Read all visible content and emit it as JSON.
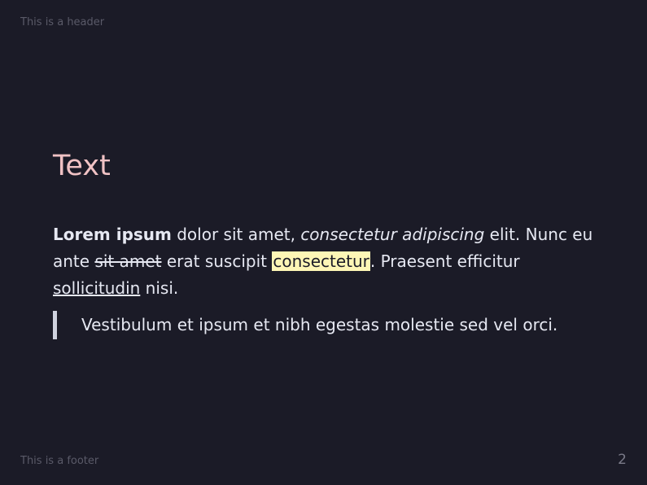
{
  "header": {
    "text": "This is a header"
  },
  "title": "Text",
  "paragraph": {
    "bold": "Lorem ipsum",
    "text1": " dolor sit amet, ",
    "italic": "consectetur adipiscing",
    "text2": " elit. Nunc eu ante ",
    "strike": "sit amet",
    "text3": " erat suscipit ",
    "highlight": "consectetur",
    "text4": ". Praesent efficitur ",
    "underline": "sollicitudin",
    "text5": " nisi."
  },
  "blockquote": "Vestibulum et ipsum et nibh egestas molestie sed vel orci.",
  "footer": {
    "text": "This is a footer",
    "page_number": "2"
  },
  "colors": {
    "background": "#1b1b27",
    "title": "#f0c2c4",
    "body_text": "#e6e8f2",
    "highlight_bg": "#fdf6b6",
    "muted": "#5a5a68"
  }
}
